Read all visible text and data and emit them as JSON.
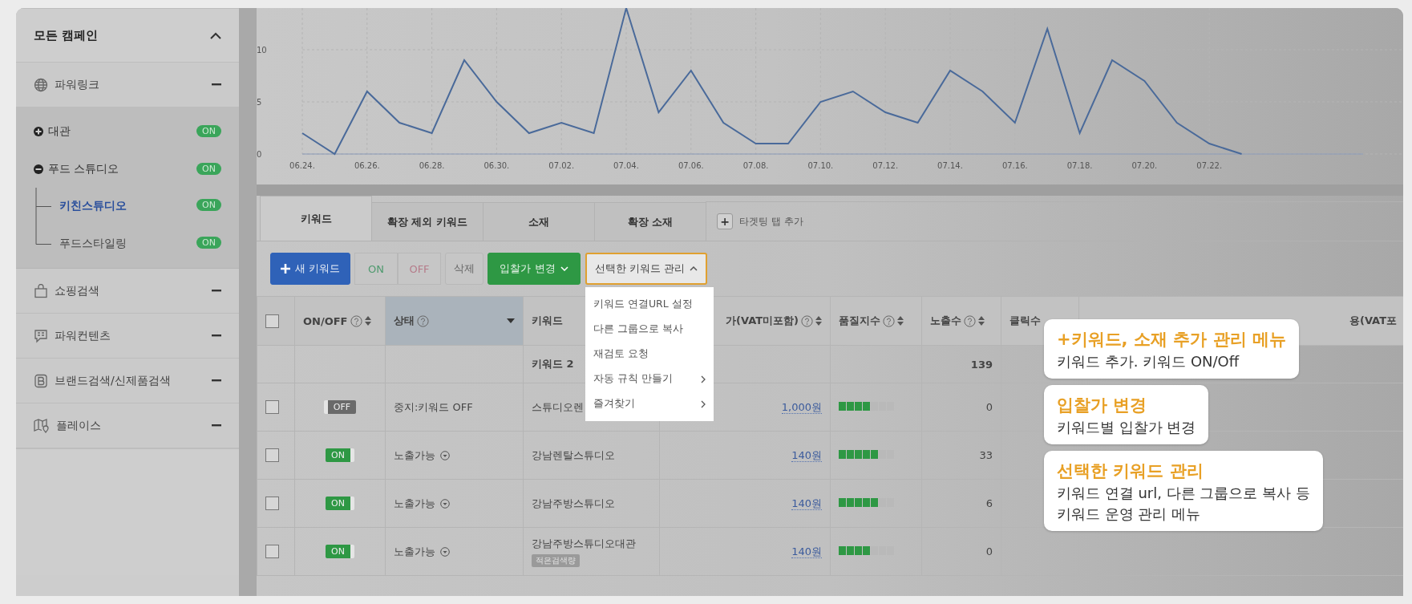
{
  "sidebar": {
    "title": "모든 캠페인",
    "expanded": true,
    "categories": [
      {
        "label": "파워링크",
        "campaigns": [
          {
            "label": "대관",
            "expanded": false,
            "badge": "ON"
          },
          {
            "label": "푸드 스튜디오",
            "expanded": true,
            "badge": "ON",
            "children": [
              {
                "label": "키친스튜디오",
                "selected": true,
                "badge": "ON"
              },
              {
                "label": "푸드스타일링",
                "selected": false,
                "badge": "ON"
              }
            ]
          }
        ]
      },
      {
        "label": "쇼핑검색"
      },
      {
        "label": "파워컨텐츠"
      },
      {
        "label": "브랜드검색/신제품검색"
      },
      {
        "label": "플레이스"
      }
    ]
  },
  "chart": {
    "chart_data": {
      "type": "line",
      "grid": true,
      "ylim": [
        0,
        14
      ],
      "yticks": [
        0,
        5,
        10
      ],
      "categories": [
        "06.24.",
        null,
        "06.26.",
        null,
        "06.28.",
        null,
        "06.30.",
        null,
        "07.02.",
        null,
        "07.04.",
        null,
        "07.06.",
        null,
        "07.08.",
        null,
        "07.10.",
        null,
        "07.12.",
        null,
        "07.14.",
        null,
        "07.16.",
        null,
        "07.18.",
        null,
        "07.20.",
        null,
        "07.22.",
        null
      ],
      "series": [
        {
          "color": "#4a6a9a",
          "values": [
            2,
            0,
            6,
            3,
            2,
            9,
            5,
            2,
            3,
            2,
            14,
            4,
            8,
            3,
            1,
            1,
            5,
            6,
            4,
            3,
            8,
            6,
            3,
            12,
            2,
            9,
            7,
            3,
            1,
            0
          ]
        }
      ]
    }
  },
  "tabs": [
    {
      "label": "키워드",
      "selected": true
    },
    {
      "label": "확장 제외 키워드",
      "selected": false
    },
    {
      "label": "소재",
      "selected": false
    },
    {
      "label": "확장 소재",
      "selected": false
    }
  ],
  "add_tab": {
    "icon_text": "+",
    "label": "타겟팅 탭 추가"
  },
  "toolbar": {
    "new_keyword": "새 키워드",
    "on": "ON",
    "off": "OFF",
    "delete": "삭제",
    "bid_change": "입찰가 변경",
    "manage": "선택한 키워드 관리",
    "manage_open": true
  },
  "manage_menu": [
    {
      "label": "키워드 연결URL 설정",
      "submenu": false
    },
    {
      "label": "다른 그룹으로 복사",
      "submenu": false
    },
    {
      "label": "재검토 요청",
      "submenu": false
    },
    {
      "label": "자동 규칙 만들기",
      "submenu": true
    },
    {
      "label": "즐겨찾기",
      "submenu": true
    }
  ],
  "table": {
    "all_checked": false,
    "columns": [
      {
        "label": "ON/OFF",
        "help": true,
        "sort": true,
        "selected": false
      },
      {
        "label": "상태",
        "help": true,
        "sort": false,
        "selected": true
      },
      {
        "label": "키워드",
        "help": false,
        "sort": false,
        "selected": false
      },
      {
        "label": "가(VAT미포함)",
        "help": true,
        "sort": true,
        "selected": false
      },
      {
        "label": "품질지수",
        "help": true,
        "sort": true,
        "selected": false
      },
      {
        "label": "노출수",
        "help": true,
        "sort": true,
        "selected": false
      },
      {
        "label": "클릭수",
        "help": false,
        "sort": false,
        "selected": false
      },
      {
        "label": "용(VAT포",
        "help": false,
        "sort": false,
        "selected": false
      }
    ],
    "total": {
      "keyword": "키워드 2",
      "impressions": "139"
    },
    "rows": [
      {
        "checked": false,
        "on": false,
        "toggle": "OFF",
        "status": "중지:키워드 OFF",
        "status_menu": false,
        "keyword": "스튜디오렌",
        "bid": "1,000원",
        "quality": {
          "level": 0.57
        },
        "impressions": "0"
      },
      {
        "checked": false,
        "on": true,
        "toggle": "ON",
        "status": "노출가능",
        "status_menu": true,
        "keyword": "강남렌탈스튜디오",
        "bid": "140원",
        "quality": {
          "level": 0.71
        },
        "impressions": "33"
      },
      {
        "checked": false,
        "on": true,
        "toggle": "ON",
        "status": "노출가능",
        "status_menu": true,
        "keyword": "강남주방스튜디오",
        "bid": "140원",
        "quality": {
          "level": 0.71
        },
        "impressions": "6"
      },
      {
        "checked": false,
        "on": true,
        "toggle": "ON",
        "status": "노출가능",
        "status_menu": true,
        "keyword": "강남주방스튜디오대관",
        "tag": "적은검색량",
        "bid": "140원",
        "quality": {
          "level": 0.57
        },
        "impressions": "0"
      }
    ]
  },
  "callouts": [
    {
      "title": "+키워드, 소재 추가 관리 메뉴",
      "lines": [
        "키워드 추가. 키워드 ON/Off"
      ]
    },
    {
      "title": "입찰가 변경",
      "lines": [
        "키워드별 입찰가 변경"
      ]
    },
    {
      "title": "선택한 키워드 관리",
      "lines": [
        "키워드 연결 url, 다른 그룹으로 복사 등",
        "키워드 운영 관리 메뉴"
      ]
    }
  ]
}
